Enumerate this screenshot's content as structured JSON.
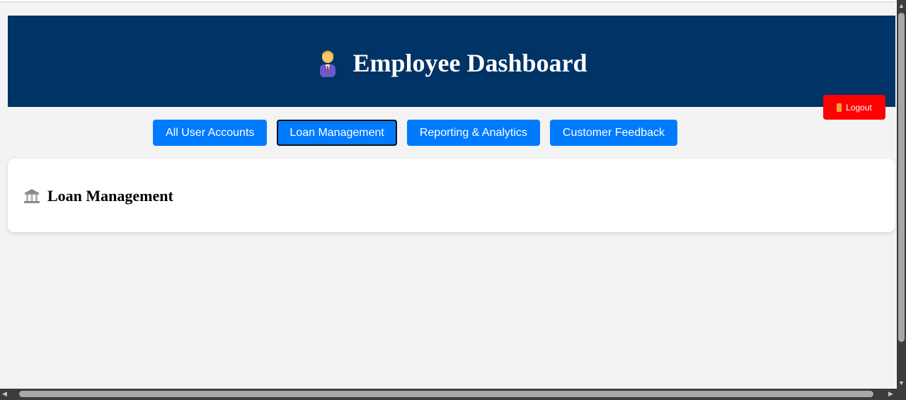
{
  "header": {
    "title": "Employee Dashboard",
    "icon": "office-worker-icon",
    "bg_color": "#003366"
  },
  "logout": {
    "label": "Logout",
    "icon": "door-icon",
    "color": "#ff0000"
  },
  "nav": {
    "items": [
      {
        "label": "All User Accounts",
        "active": false
      },
      {
        "label": "Loan Management",
        "active": true
      },
      {
        "label": "Reporting & Analytics",
        "active": false
      },
      {
        "label": "Customer Feedback",
        "active": false
      }
    ],
    "color": "#007bff"
  },
  "section": {
    "title": "Loan Management",
    "icon": "bank-icon"
  }
}
